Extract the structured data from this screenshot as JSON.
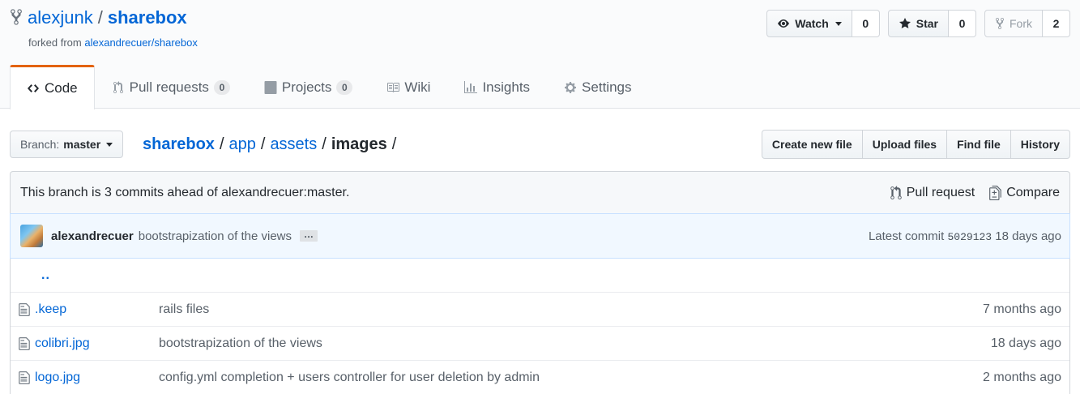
{
  "repo": {
    "owner": "alexjunk",
    "separator": "/",
    "name": "sharebox",
    "forked_from_prefix": "forked from",
    "forked_from_link": "alexandrecuer/sharebox"
  },
  "actions": {
    "watch_label": "Watch",
    "watch_count": "0",
    "star_label": "Star",
    "star_count": "0",
    "fork_label": "Fork",
    "fork_count": "2"
  },
  "nav": {
    "code": "Code",
    "pull_requests": "Pull requests",
    "pull_requests_count": "0",
    "projects": "Projects",
    "projects_count": "0",
    "wiki": "Wiki",
    "insights": "Insights",
    "settings": "Settings"
  },
  "file_nav": {
    "branch_prefix": "Branch:",
    "branch_name": "master",
    "breadcrumb_root": "sharebox",
    "breadcrumb_1": "app",
    "breadcrumb_2": "assets",
    "breadcrumb_final": "images",
    "create_new_file": "Create new file",
    "upload_files": "Upload files",
    "find_file": "Find file",
    "history": "History"
  },
  "branch_info": {
    "message": "This branch is 3 commits ahead of alexandrecuer:master.",
    "pull_request": "Pull request",
    "compare": "Compare"
  },
  "latest_commit": {
    "author": "alexandrecuer",
    "message": "bootstrapization of the views",
    "ellipsis": "…",
    "prefix": "Latest commit",
    "sha": "5029123",
    "age": "18 days ago"
  },
  "files": {
    "up_dir": "..",
    "rows": [
      {
        "name": ".keep",
        "message": "rails files",
        "age": "7 months ago"
      },
      {
        "name": "colibri.jpg",
        "message": "bootstrapization of the views",
        "age": "18 days ago"
      },
      {
        "name": "logo.jpg",
        "message": "config.yml completion + users controller for user deletion by admin",
        "age": "2 months ago"
      }
    ]
  },
  "colors": {
    "link": "#0366d6",
    "nav_selected_accent": "#e36209",
    "commit_tease_bg": "#f1f8ff"
  }
}
